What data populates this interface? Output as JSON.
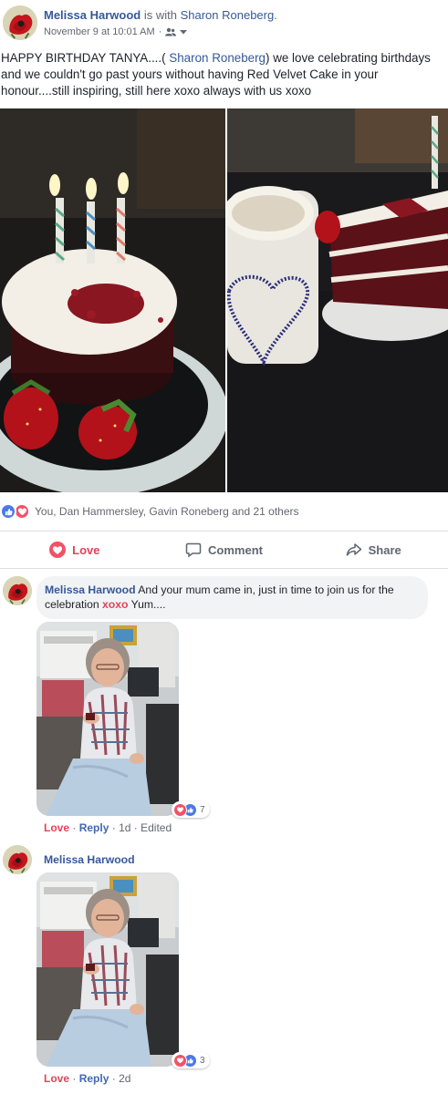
{
  "post": {
    "author": "Melissa Harwood",
    "with_text": "is with",
    "tagged": "Sharon Roneberg",
    "tagged_suffix": ".",
    "date": "November 9 at 10:01 AM",
    "date_sep": "·",
    "privacy_icon": "friends-icon",
    "text_part1": "HAPPY BIRTHDAY TANYA....( ",
    "text_tag": "Sharon Roneberg",
    "text_part2": ") we love celebrating birthdays and we couldn't go past yours without having Red Velvet Cake in your honour....still inspiring, still here xoxo always with us xoxo"
  },
  "photos": [
    {
      "alt": "Red velvet cake with three birthday candles and strawberries"
    },
    {
      "alt": "Coffee mug with heart and sliced red velvet cake"
    }
  ],
  "reactions": {
    "icons": [
      "like-icon",
      "love-icon"
    ],
    "summary": "You, Dan Hammersley, Gavin Roneberg and 21 others"
  },
  "actions": {
    "love": "Love",
    "comment": "Comment",
    "share": "Share"
  },
  "comments": [
    {
      "author": "Melissa Harwood",
      "text_part1": "And your mum came in, just in time to join us for the celebration ",
      "highlight": "xoxo",
      "text_part2": " Yum....",
      "reaction_count": "7",
      "love": "Love",
      "reply": "Reply",
      "time": "1d",
      "edited": "Edited",
      "sep": "·"
    },
    {
      "author": "Melissa Harwood",
      "reaction_count": "3",
      "love": "Love",
      "reply": "Reply",
      "time": "2d",
      "sep": "·"
    }
  ],
  "colors": {
    "link_blue": "#365899",
    "love_red": "#e0445a",
    "like_blue": "#4a7ae8",
    "bubble_bg": "#f2f3f5"
  }
}
